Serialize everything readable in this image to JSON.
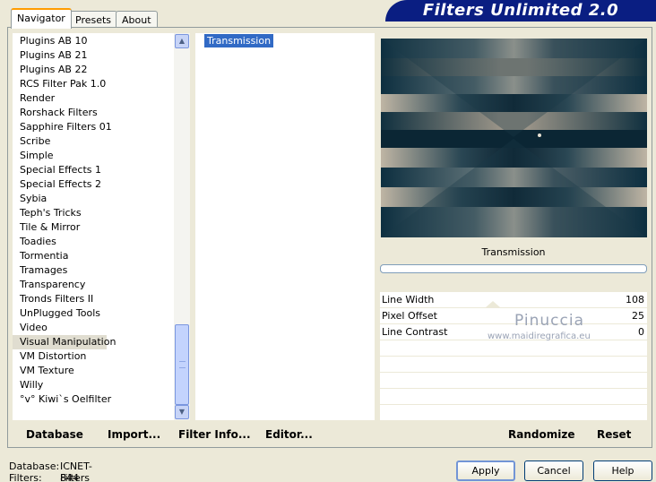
{
  "tabs": [
    "Navigator",
    "Presets",
    "About"
  ],
  "title": "Filters Unlimited 2.0",
  "categories": [
    "Plugins AB 10",
    "Plugins AB 21",
    "Plugins AB 22",
    "RCS Filter Pak 1.0",
    "Render",
    "Rorshack Filters",
    "Sapphire Filters 01",
    "Scribe",
    "Simple",
    "Special Effects 1",
    "Special Effects 2",
    "Sybia",
    "Teph's Tricks",
    "Tile & Mirror",
    "Toadies",
    "Tormentia",
    "Tramages",
    "Transparency",
    "Tronds Filters II",
    "UnPlugged Tools",
    "Video",
    "Visual Manipulation",
    "VM Distortion",
    "VM Texture",
    "Willy",
    "°v° Kiwi`s Oelfilter"
  ],
  "selected_category": "Visual Manipulation",
  "filters": [
    "Transmission"
  ],
  "selected_filter_name": "Transmission",
  "params": [
    {
      "label": "Line Width",
      "value": "108"
    },
    {
      "label": "Pixel Offset",
      "value": "25"
    },
    {
      "label": "Line Contrast",
      "value": "0"
    }
  ],
  "watermark": {
    "name": "Pinuccia",
    "site": "www.maidiregrafica.eu"
  },
  "link_buttons": {
    "database": "Database",
    "import": "Import...",
    "filter_info": "Filter Info...",
    "editor": "Editor...",
    "randomize": "Randomize",
    "reset": "Reset"
  },
  "status": {
    "db_label": "Database:",
    "db_value": "ICNET-Filters",
    "filters_label": "Filters:",
    "filters_value": "844"
  },
  "buttons": {
    "apply": "Apply",
    "cancel": "Cancel",
    "help": "Help"
  },
  "colors": {
    "banner": "#0a1e82",
    "selection": "#316ac5",
    "accent_tab": "#ff9c00"
  },
  "icons": {
    "scroll_up": "chevron-up-icon",
    "scroll_down": "chevron-down-icon"
  }
}
